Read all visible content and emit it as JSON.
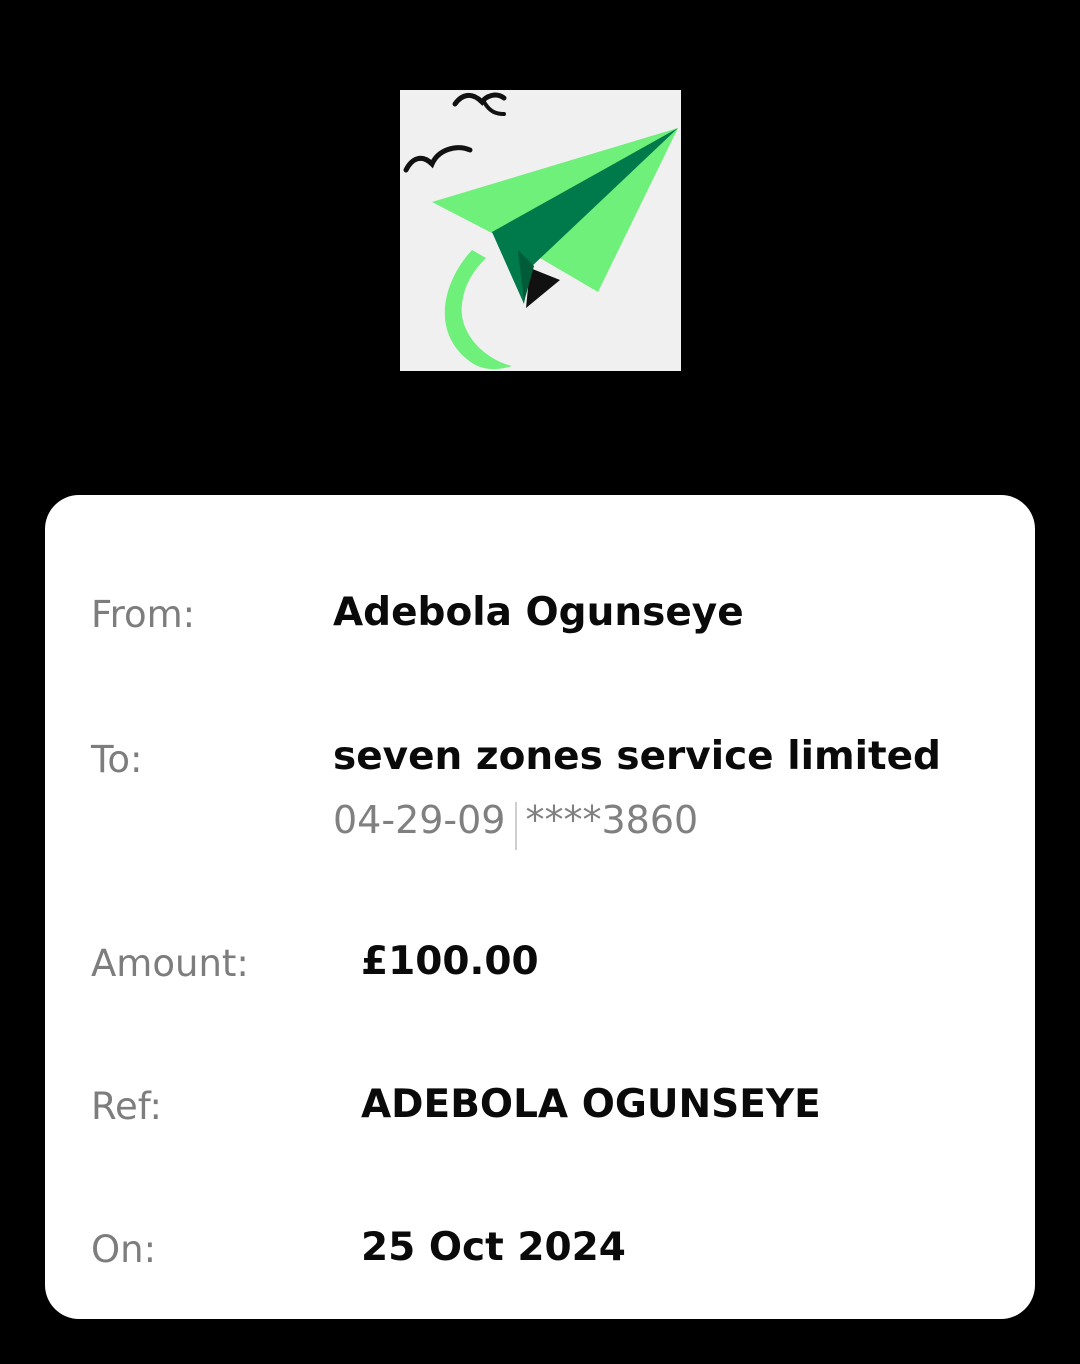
{
  "logo": {
    "icon": "paper-plane-logo",
    "colors": {
      "background": "#f0f0f0",
      "plane_light": "#6ef07a",
      "plane_dark": "#007a4a",
      "birds": "#111111"
    }
  },
  "receipt": {
    "from": {
      "label": "From:",
      "value": "Adebola Ogunseye"
    },
    "to": {
      "label": "To:",
      "value": "seven zones service limited",
      "sort_code": "04-29-09",
      "account": "****3860"
    },
    "amount": {
      "label": "Amount:",
      "value": "£100.00"
    },
    "ref": {
      "label": "Ref:",
      "value": "ADEBOLA OGUNSEYE"
    },
    "on": {
      "label": "On:",
      "value": "25 Oct 2024"
    }
  }
}
